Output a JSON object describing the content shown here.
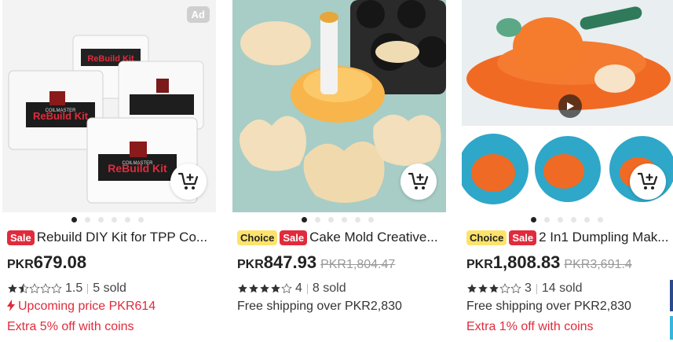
{
  "products": [
    {
      "ad_label": "Ad",
      "tags": [
        {
          "type": "sale",
          "label": "Sale"
        }
      ],
      "title": "Rebuild DIY Kit for TPP Co...",
      "currency": "PKR",
      "price": "679.08",
      "rating": "1.5",
      "rating_stars": 1.5,
      "sold": "5 sold",
      "line4": "Upcoming price PKR614",
      "line5": "Extra 5% off with coins",
      "image_text": {
        "kit_title": "ReBuild Kit",
        "brand": "COILMASTER"
      }
    },
    {
      "tags": [
        {
          "type": "choice",
          "label": "Choice"
        },
        {
          "type": "sale",
          "label": "Sale"
        }
      ],
      "title": "Cake Mold Creative...",
      "currency": "PKR",
      "price": "847.93",
      "old_price": "PKR1,804.47",
      "rating": "4",
      "rating_stars": 4,
      "sold": "8 sold",
      "line4": "Free shipping over PKR2,830"
    },
    {
      "tags": [
        {
          "type": "choice",
          "label": "Choice"
        },
        {
          "type": "sale",
          "label": "Sale"
        }
      ],
      "title": "2 In1 Dumpling Mak...",
      "currency": "PKR",
      "price": "1,808.83",
      "old_price": "PKR3,691.4",
      "rating": "3",
      "rating_stars": 3,
      "sold": "14 sold",
      "line4": "Free shipping over PKR2,830",
      "line5": "Extra 1% off with coins"
    }
  ],
  "icons": {
    "cart": "add-to-cart-icon",
    "play": "play-icon",
    "lightning": "lightning-icon",
    "star": "star-icon"
  },
  "colors": {
    "sale_red": "#e02b3c",
    "choice_yellow": "#fde36b",
    "star_dark": "#333333",
    "star_empty": "#cccccc",
    "dot_active": "#222222",
    "dot_inactive": "#e6e6e6"
  },
  "carousel": {
    "dot_count": 6,
    "active_index": 0
  }
}
